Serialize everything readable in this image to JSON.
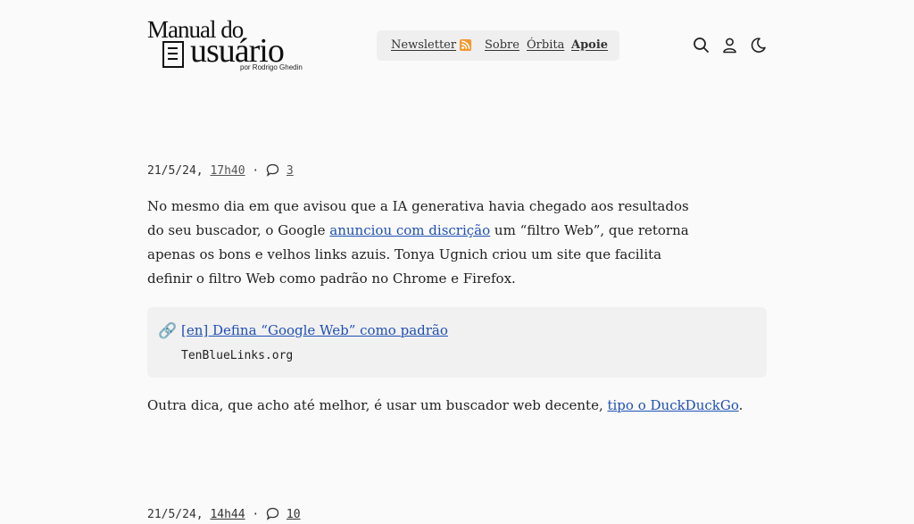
{
  "logo": {
    "line1": "Manual do",
    "line2": "usuário",
    "byline": "por Rodrigo Ghedin"
  },
  "nav": {
    "items": [
      "Newsletter",
      "Sobre",
      "Órbita",
      "Apoie"
    ],
    "rss_color": "#f29a2e"
  },
  "header_icons": [
    "search-icon",
    "user-icon",
    "moon-icon"
  ],
  "post": {
    "date": "21/5/24,",
    "time": "17h40",
    "separator": "·",
    "comments": "3",
    "p1_a": "No mesmo dia em que avisou que a IA generativa havia chegado aos resultados do seu buscador, o Google ",
    "p1_link": "anunciou com discrição",
    "p1_b": " um “filtro Web”, que retorna apenas os bons e velhos links azuis. Tonya Ugnich criou um site que facilita definir o filtro Web como padrão no Chrome e Firefox.",
    "linkbox": {
      "title": "[en] Defina “Google Web” como padrão",
      "source": "TenBlueLinks.org"
    },
    "p2_a": "Outra dica, que acho até melhor, é usar um buscador web decente, ",
    "p2_link": "tipo o DuckDuckGo",
    "p2_b": "."
  },
  "next_post": {
    "date": "21/5/24,",
    "time": "14h44",
    "separator": "·",
    "comments": "10"
  },
  "colors": {
    "link": "#1f4fb4",
    "background": "#fafafa",
    "nav_bg": "#efefef",
    "box_bg": "#f1f1f1"
  }
}
